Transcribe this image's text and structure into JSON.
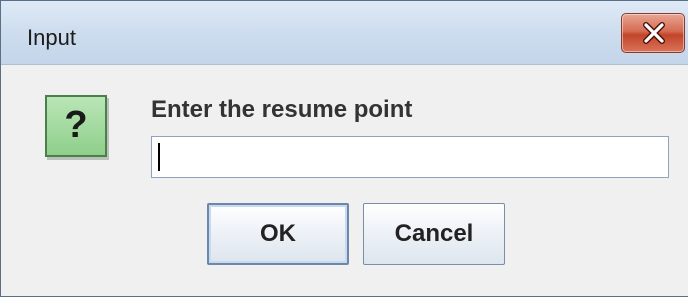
{
  "window": {
    "title": "Input"
  },
  "dialog": {
    "icon_symbol": "?",
    "prompt": "Enter the resume point",
    "input_value": "",
    "ok_label": "OK",
    "cancel_label": "Cancel"
  },
  "icons": {
    "close": "close-icon",
    "question": "question-icon"
  },
  "colors": {
    "titlebar": "#cfdeef",
    "close_button": "#c2452a",
    "question_icon": "#8fcf8b",
    "background": "#f0f0f0"
  }
}
